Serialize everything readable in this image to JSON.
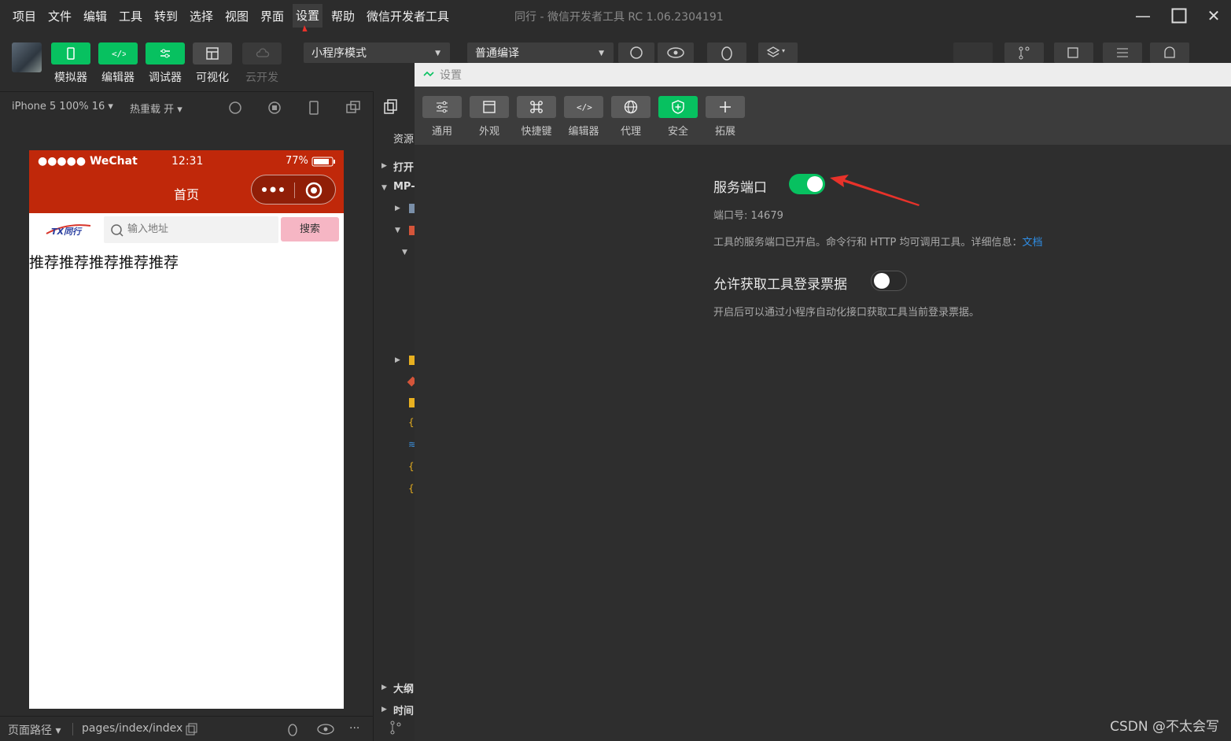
{
  "menubar": {
    "items": [
      "项目",
      "文件",
      "编辑",
      "工具",
      "转到",
      "选择",
      "视图",
      "界面",
      "设置",
      "帮助",
      "微信开发者工具"
    ],
    "active_item": "设置",
    "window_title": "同行 - 微信开发者工具 RC 1.06.2304191"
  },
  "toolbar": {
    "buttons": [
      {
        "label": "模拟器",
        "icon": "phone-icon"
      },
      {
        "label": "编辑器",
        "icon": "code-icon"
      },
      {
        "label": "调试器",
        "icon": "debug-icon"
      },
      {
        "label": "可视化",
        "icon": "layout-icon"
      },
      {
        "label": "云开发",
        "icon": "cloud-icon"
      }
    ],
    "mode_select": "小程序模式",
    "compile_select": "普通编译"
  },
  "simulator": {
    "device": "iPhone 5 100% 16",
    "hot_reload": "热重载 开",
    "footer_path_label": "页面路径",
    "footer_path": "pages/index/index"
  },
  "phone": {
    "carrier": "●●●●● WeChat",
    "time": "12:31",
    "battery": "77%",
    "title": "首页",
    "logo_text": "TX同行",
    "search_placeholder": "输入地址",
    "search_button": "搜索",
    "recommend_text": "推荐推荐推荐推荐推荐"
  },
  "file_panel": {
    "header": "资源",
    "open": "打开",
    "mp": "MP-",
    "outline": "大纲",
    "timeline": "时间"
  },
  "settings": {
    "title": "设置",
    "tabs": [
      {
        "label": "通用",
        "icon": "sliders-icon"
      },
      {
        "label": "外观",
        "icon": "window-icon"
      },
      {
        "label": "快捷键",
        "icon": "command-icon"
      },
      {
        "label": "编辑器",
        "icon": "code-icon"
      },
      {
        "label": "代理",
        "icon": "globe-icon"
      },
      {
        "label": "安全",
        "icon": "shield-icon"
      },
      {
        "label": "拓展",
        "icon": "plus-icon"
      }
    ],
    "active_tab": "安全",
    "service_port": {
      "title": "服务端口",
      "enabled": true,
      "port_label": "端口号: 14679",
      "desc": "工具的服务端口已开启。命令行和 HTTP 均可调用工具。详细信息：",
      "link": "文档"
    },
    "login_ticket": {
      "title": "允许获取工具登录票据",
      "enabled": false,
      "desc": "开启后可以通过小程序自动化接口获取工具当前登录票据。"
    }
  },
  "watermark": "CSDN @不太会写",
  "colors": {
    "accent_green": "#07c160",
    "phone_header_red": "#c0280a",
    "arrow_red": "#e8322a",
    "link_blue": "#2f8de4"
  }
}
